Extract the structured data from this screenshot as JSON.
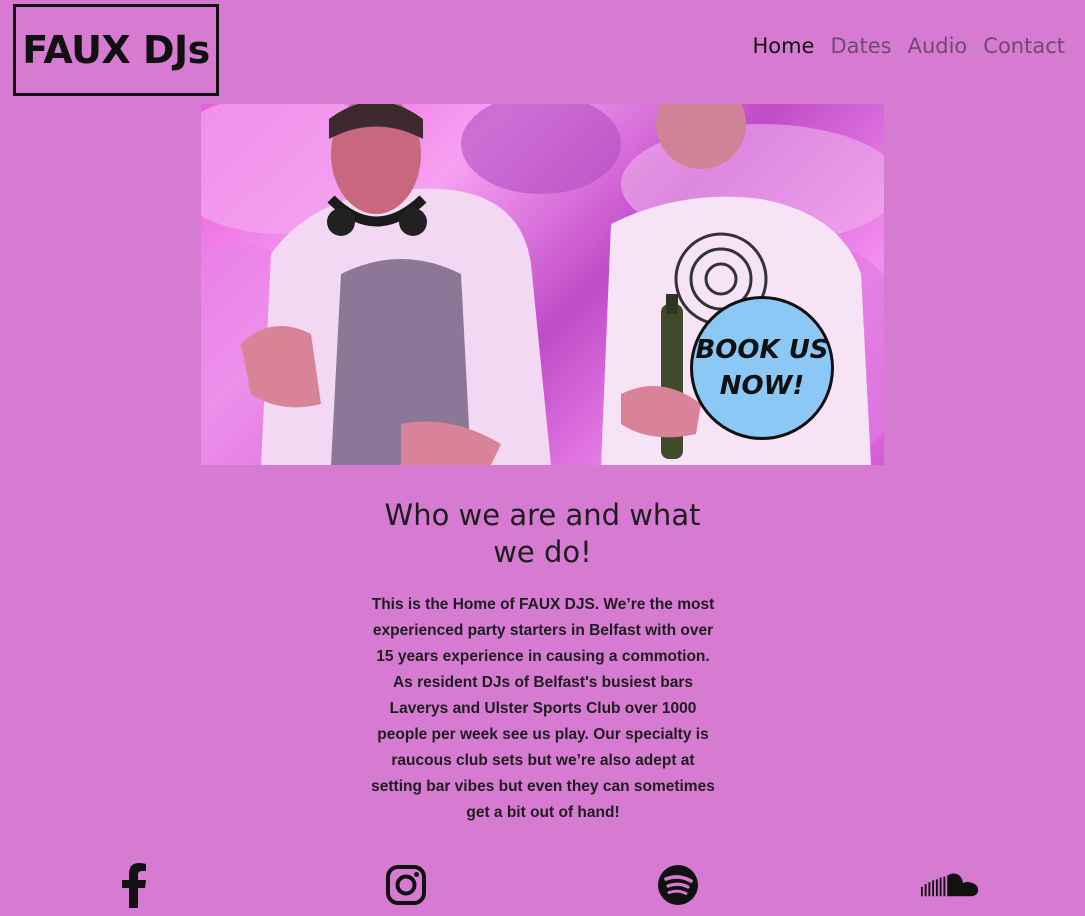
{
  "site": {
    "logo_text": "FAUX DJs"
  },
  "nav": {
    "items": [
      {
        "label": "Home",
        "active": true
      },
      {
        "label": "Dates",
        "active": false
      },
      {
        "label": "Audio",
        "active": false
      },
      {
        "label": "Contact",
        "active": false
      }
    ]
  },
  "hero": {
    "badge_text": "BOOK US\nNOW!"
  },
  "about": {
    "title": "Who we are and what we do!",
    "body": "This is the Home of FAUX DJS. We’re the most experienced party starters in Belfast with over 15 years experience in causing a commotion. As resident DJs of Belfast's busiest bars Laverys and Ulster Sports Club over 1000 people per week see us play. Our specialty is raucous club sets but we’re also adept at setting bar vibes but even they can sometimes get a bit out of hand!"
  },
  "social": {
    "icons": [
      "facebook-icon",
      "instagram-icon",
      "spotify-icon",
      "soundcloud-icon"
    ]
  },
  "colors": {
    "background": "#d77bd2",
    "badge": "#8cc8f5",
    "nav_inactive": "#6d4a71",
    "nav_active": "#111111"
  }
}
